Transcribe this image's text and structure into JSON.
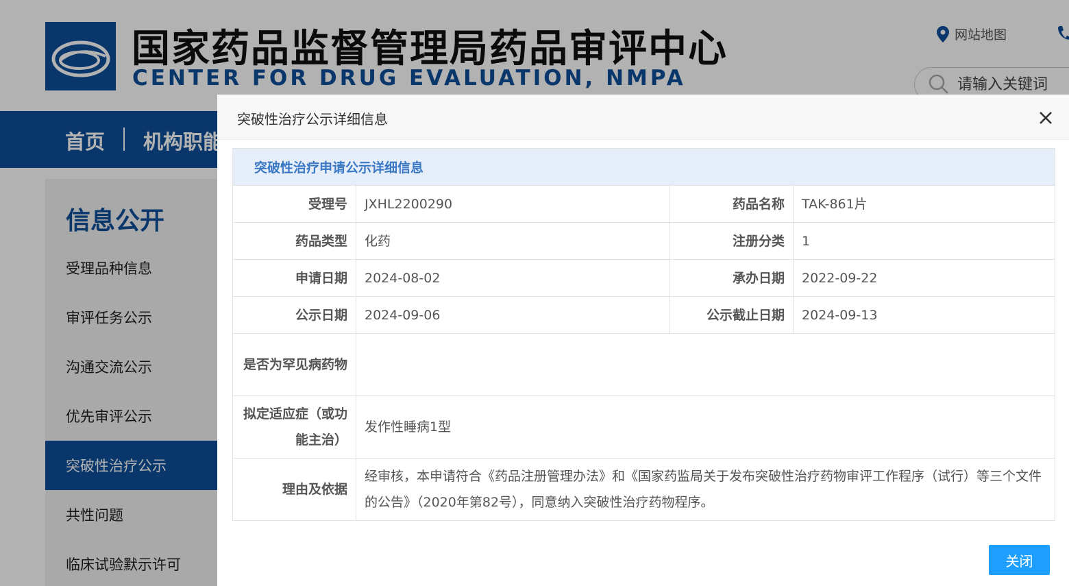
{
  "header": {
    "title": "国家药品监督管理局药品审评中心",
    "subtitle": "CENTER FOR DRUG EVALUATION, NMPA",
    "sitemap_label": "网站地图",
    "search_placeholder": "请输入关键词"
  },
  "nav": {
    "items": [
      "首页",
      "机构职能"
    ]
  },
  "sidebar": {
    "title": "信息公开",
    "items": [
      {
        "label": "受理品种信息"
      },
      {
        "label": "审评任务公示"
      },
      {
        "label": "沟通交流公示"
      },
      {
        "label": "优先审评公示"
      },
      {
        "label": "突破性治疗公示",
        "active": true
      },
      {
        "label": "共性问题"
      },
      {
        "label": "临床试验默示许可"
      }
    ]
  },
  "modal": {
    "title": "突破性治疗公示详细信息",
    "section_title": "突破性治疗申请公示详细信息",
    "fields": {
      "acceptance_no": {
        "label": "受理号",
        "value": "JXHL2200290"
      },
      "drug_name": {
        "label": "药品名称",
        "value": "TAK-861片"
      },
      "drug_type": {
        "label": "药品类型",
        "value": "化药"
      },
      "registration_class": {
        "label": "注册分类",
        "value": "1"
      },
      "application_date": {
        "label": "申请日期",
        "value": "2024-08-02"
      },
      "handling_date": {
        "label": "承办日期",
        "value": "2022-09-22"
      },
      "publicity_date": {
        "label": "公示日期",
        "value": "2024-09-06"
      },
      "publicity_deadline": {
        "label": "公示截止日期",
        "value": "2024-09-13"
      },
      "rare_disease": {
        "label": "是否为罕见病药物",
        "value": ""
      },
      "indication": {
        "label": "拟定适应症（或功能主治）",
        "value": "发作性睡病1型"
      },
      "reason": {
        "label": "理由及依据",
        "value": "经审核，本申请符合《药品注册管理办法》和《国家药监局关于发布突破性治疗药物审评工作程序（试行）等三个文件的公告》（2020年第82号），同意纳入突破性治疗药物程序。"
      }
    },
    "close_button": "关闭"
  },
  "colors": {
    "brand_blue": "#0d4f9a",
    "section_header_bg": "#e6eef9",
    "section_header_text": "#3a78c3",
    "button_blue": "#1e9fff"
  }
}
